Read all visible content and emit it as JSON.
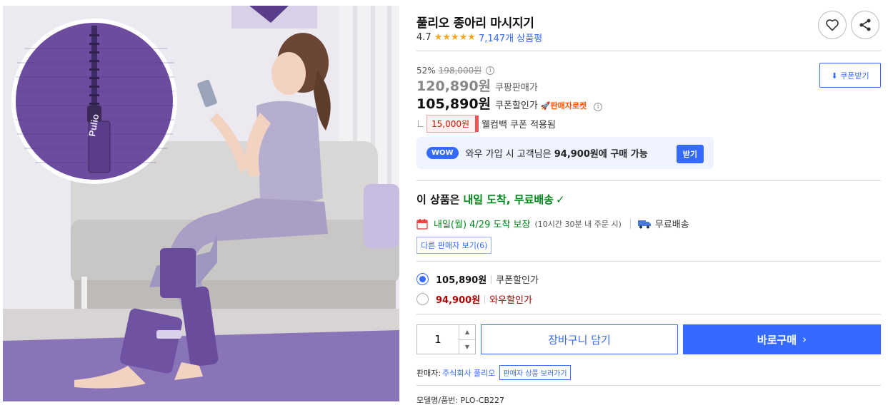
{
  "product": {
    "title": "풀리오 종아리 마시지기",
    "rating": "4.7",
    "stars": "★★★★★",
    "review_count": "7,147개 상품평"
  },
  "image": {
    "brand_tag": "Pulio"
  },
  "pricing": {
    "discount_pct": "52%",
    "original_price": "198,000원",
    "info_glyph": "i",
    "sale_price": "120,890원",
    "sale_label": "쿠팡판매가",
    "coupon_price": "105,890원",
    "coupon_label": "쿠폰할인가",
    "rocket_badge": "🚀판매자로켓",
    "coupon_button": "⬇ 쿠폰받기",
    "welcome_amount": "15,000원",
    "welcome_text": "웰컴백 쿠폰 적용됨"
  },
  "wow": {
    "badge": "WOW",
    "text_pre": "와우 가입 시 고객님은 ",
    "text_bold": "94,900원에 구매 가능",
    "button": "받기"
  },
  "delivery": {
    "headline_pre": "이 상품은",
    "headline_green": "내일 도착, 무료배송",
    "check": "✓",
    "arrival": "내일(월) 4/29 도착 보장",
    "cutoff": "(10시간 30분 내 주문 시)",
    "free_shipping": "무료배송",
    "other_sellers": "다른 판매자 보기(6)"
  },
  "options": [
    {
      "price": "105,890원",
      "label": "쿠폰할인가",
      "selected": true
    },
    {
      "price": "94,900원",
      "label": "와우할인가",
      "selected": false
    }
  ],
  "purchase": {
    "quantity": "1",
    "up_arrow": "▲",
    "down_arrow": "▼",
    "cart_button": "장바구니 담기",
    "buy_button": "바로구매",
    "buy_chevron": "›"
  },
  "seller": {
    "label": "판매자:",
    "name": "주식회사 풀리오",
    "link": "판매자 상품 보러가기"
  },
  "model": {
    "text": "모델명/품번: PLO-CB227"
  },
  "colors": {
    "accent": "#346aff",
    "green": "#00891a",
    "red": "#ae0000",
    "star": "#f5a623",
    "purple": "#6a4c9c"
  },
  "icons": [
    "heart-icon",
    "share-icon",
    "calendar-icon",
    "truck-icon",
    "download-icon",
    "info-icon"
  ]
}
